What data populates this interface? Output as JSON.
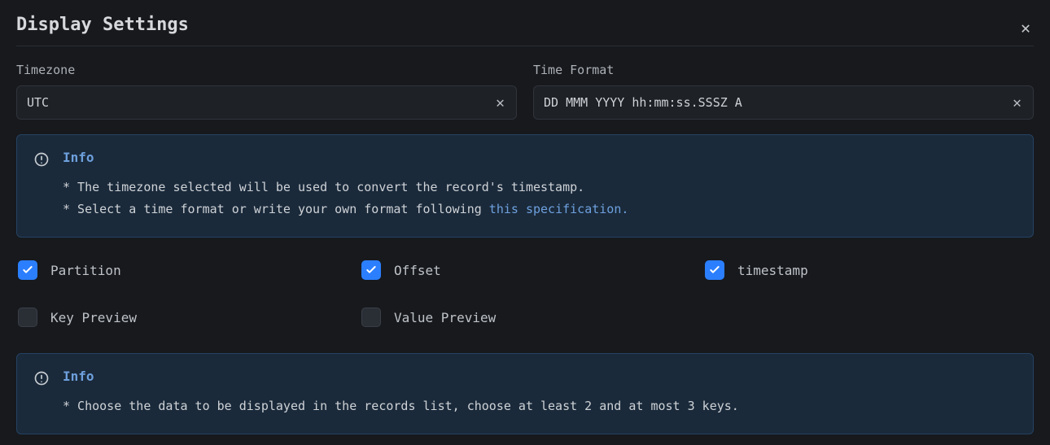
{
  "title": "Display Settings",
  "fields": {
    "timezone": {
      "label": "Timezone",
      "value": "UTC"
    },
    "time_format": {
      "label": "Time Format",
      "value": "DD MMM YYYY hh:mm:ss.SSSZ A"
    }
  },
  "info1": {
    "heading": "Info",
    "line1": "* The timezone selected will be used to convert the record's timestamp.",
    "line2_prefix": "* Select a time format or write your own format following ",
    "line2_link": "this specification."
  },
  "checks": {
    "partition": {
      "label": "Partition",
      "checked": true
    },
    "offset": {
      "label": "Offset",
      "checked": true
    },
    "timestamp": {
      "label": "timestamp",
      "checked": true
    },
    "key_preview": {
      "label": "Key Preview",
      "checked": false
    },
    "value_preview": {
      "label": "Value Preview",
      "checked": false
    }
  },
  "info2": {
    "heading": "Info",
    "line1": "* Choose the data to be displayed in the records list, choose at least 2 and at most 3 keys."
  }
}
